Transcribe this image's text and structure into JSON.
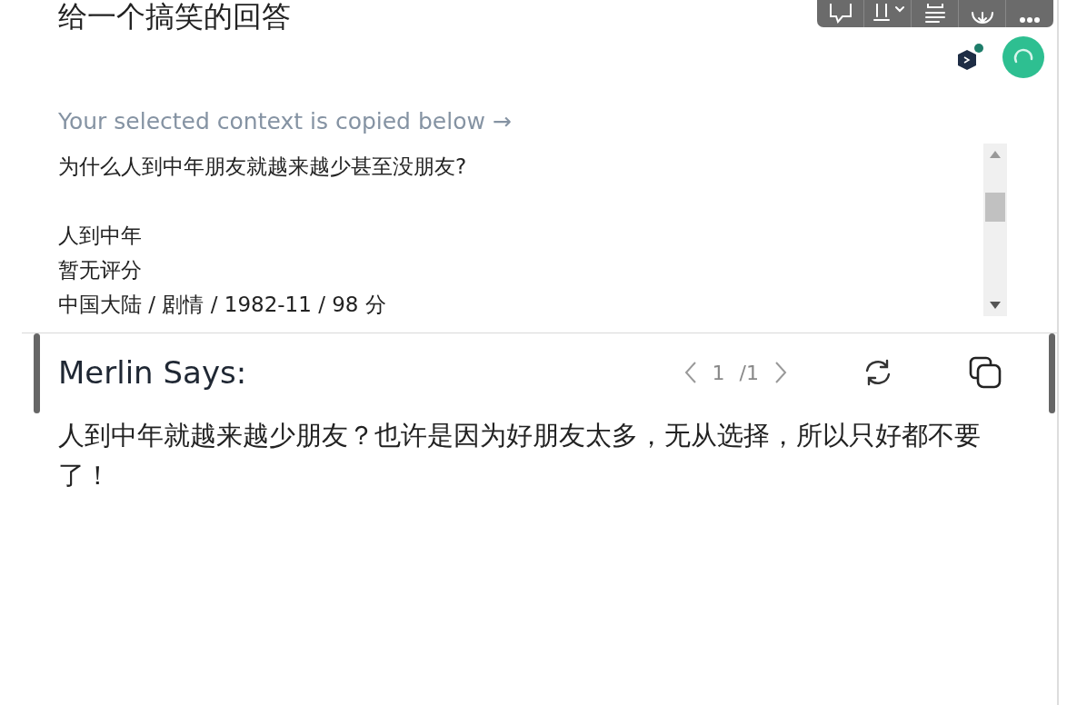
{
  "prompt": {
    "title": "给一个搞笑的回答"
  },
  "toolbar": {
    "buttons": [
      {
        "kind": "comment"
      },
      {
        "kind": "clip"
      },
      {
        "kind": "lines"
      },
      {
        "kind": "download"
      },
      {
        "kind": "more"
      }
    ]
  },
  "context": {
    "label": "Your selected context is copied below →",
    "blocks": [
      [
        "为什么人到中年朋友就越来越少甚至没朋友?"
      ],
      [
        "人到中年",
        "暂无评分",
        "中国大陆 / 剧情 / 1982-11 / 98 分"
      ]
    ]
  },
  "answer": {
    "title": "Merlin Says:",
    "page": "1",
    "total": "/1",
    "text": "人到中年就越来越少朋友？也许是因为好朋友太多，无从选择，所以只好都不要了！"
  }
}
